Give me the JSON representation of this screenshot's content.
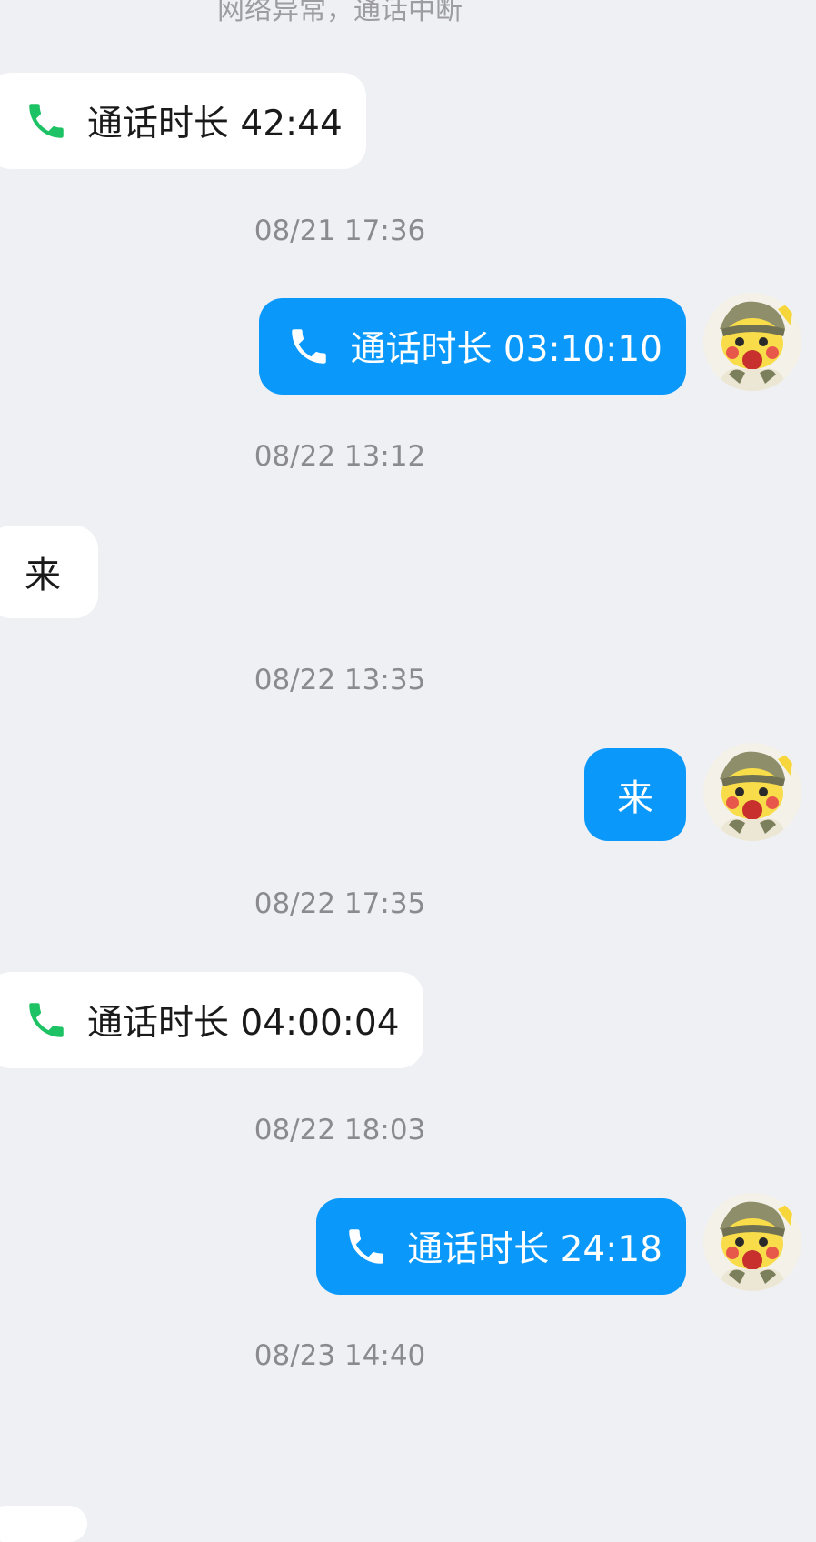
{
  "colors": {
    "background": "#eff0f4",
    "incoming_bubble": "#ffffff",
    "outgoing_bubble": "#0a99fa",
    "call_icon_incoming": "#1dc264",
    "timestamp_text": "#8a8a8f"
  },
  "system_notice": "网络异常，通话中断",
  "messages": [
    {
      "direction": "incoming",
      "kind": "call",
      "icon": "phone-icon",
      "text": "通话时长 42:44"
    },
    {
      "kind": "timestamp",
      "text": "08/21 17:36"
    },
    {
      "direction": "outgoing",
      "kind": "call",
      "icon": "phone-icon",
      "text": "通话时长 03:10:10",
      "avatar": "pikachu-avatar"
    },
    {
      "kind": "timestamp",
      "text": "08/22 13:12"
    },
    {
      "direction": "incoming",
      "kind": "text",
      "text": "来"
    },
    {
      "kind": "timestamp",
      "text": "08/22 13:35"
    },
    {
      "direction": "outgoing",
      "kind": "text",
      "text": "来",
      "avatar": "pikachu-avatar"
    },
    {
      "kind": "timestamp",
      "text": "08/22 17:35"
    },
    {
      "direction": "incoming",
      "kind": "call",
      "icon": "phone-icon",
      "text": "通话时长 04:00:04"
    },
    {
      "kind": "timestamp",
      "text": "08/22 18:03"
    },
    {
      "direction": "outgoing",
      "kind": "call",
      "icon": "phone-icon",
      "text": "通话时长 24:18",
      "avatar": "pikachu-avatar"
    },
    {
      "kind": "timestamp",
      "text": "08/23 14:40"
    }
  ]
}
